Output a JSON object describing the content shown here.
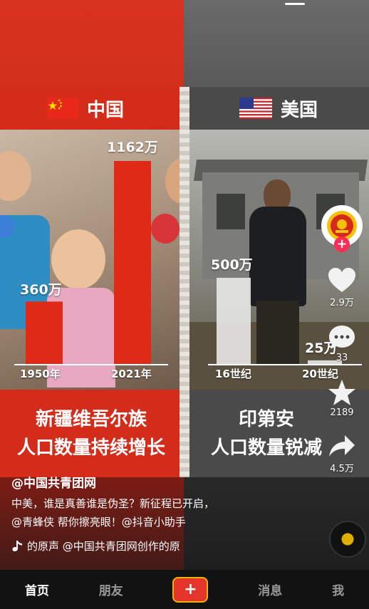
{
  "headers": {
    "left_country": "中国",
    "right_country": "美国"
  },
  "left_chart": {
    "label_first": "360万",
    "label_second": "1162万",
    "x_first": "1950年",
    "x_second": "2021年"
  },
  "right_chart": {
    "label_first": "500万",
    "label_second": "25万",
    "x_first": "16世纪",
    "x_second": "20世纪"
  },
  "chart_data": [
    {
      "type": "bar",
      "categories": [
        "1950年",
        "2021年"
      ],
      "values": [
        360,
        1162
      ],
      "title": "",
      "xlabel": "",
      "ylabel": "",
      "color": "#e02a18"
    },
    {
      "type": "bar",
      "categories": [
        "16世纪",
        "20世纪"
      ],
      "values": [
        500,
        25
      ],
      "title": "",
      "xlabel": "",
      "ylabel": "",
      "color": "#e8e8e8"
    }
  ],
  "captions": {
    "left_line1": "新疆维吾尔族",
    "left_line2": "人口数量持续增长",
    "right_line1": "印第安",
    "right_line2": "人口数量锐减"
  },
  "sidebar": {
    "like_count": "2.9万",
    "comment_count": "33",
    "favorite_count": "2189",
    "share_count": "4.5万"
  },
  "video": {
    "author": "@中国共青团网",
    "desc_line1": "中美，谁是真善谁是伪圣？新征程已开启，",
    "desc_line2": "@青蜂侠 帮你擦亮眼！@抖音小助手",
    "music": "的原声   @中国共青团网创作的原"
  },
  "nav": {
    "home": "首页",
    "friends": "朋友",
    "plus": "+",
    "messages": "消息",
    "me": "我"
  },
  "colors": {
    "accent": "#fe2c55",
    "cn_red": "#d32c1b"
  }
}
